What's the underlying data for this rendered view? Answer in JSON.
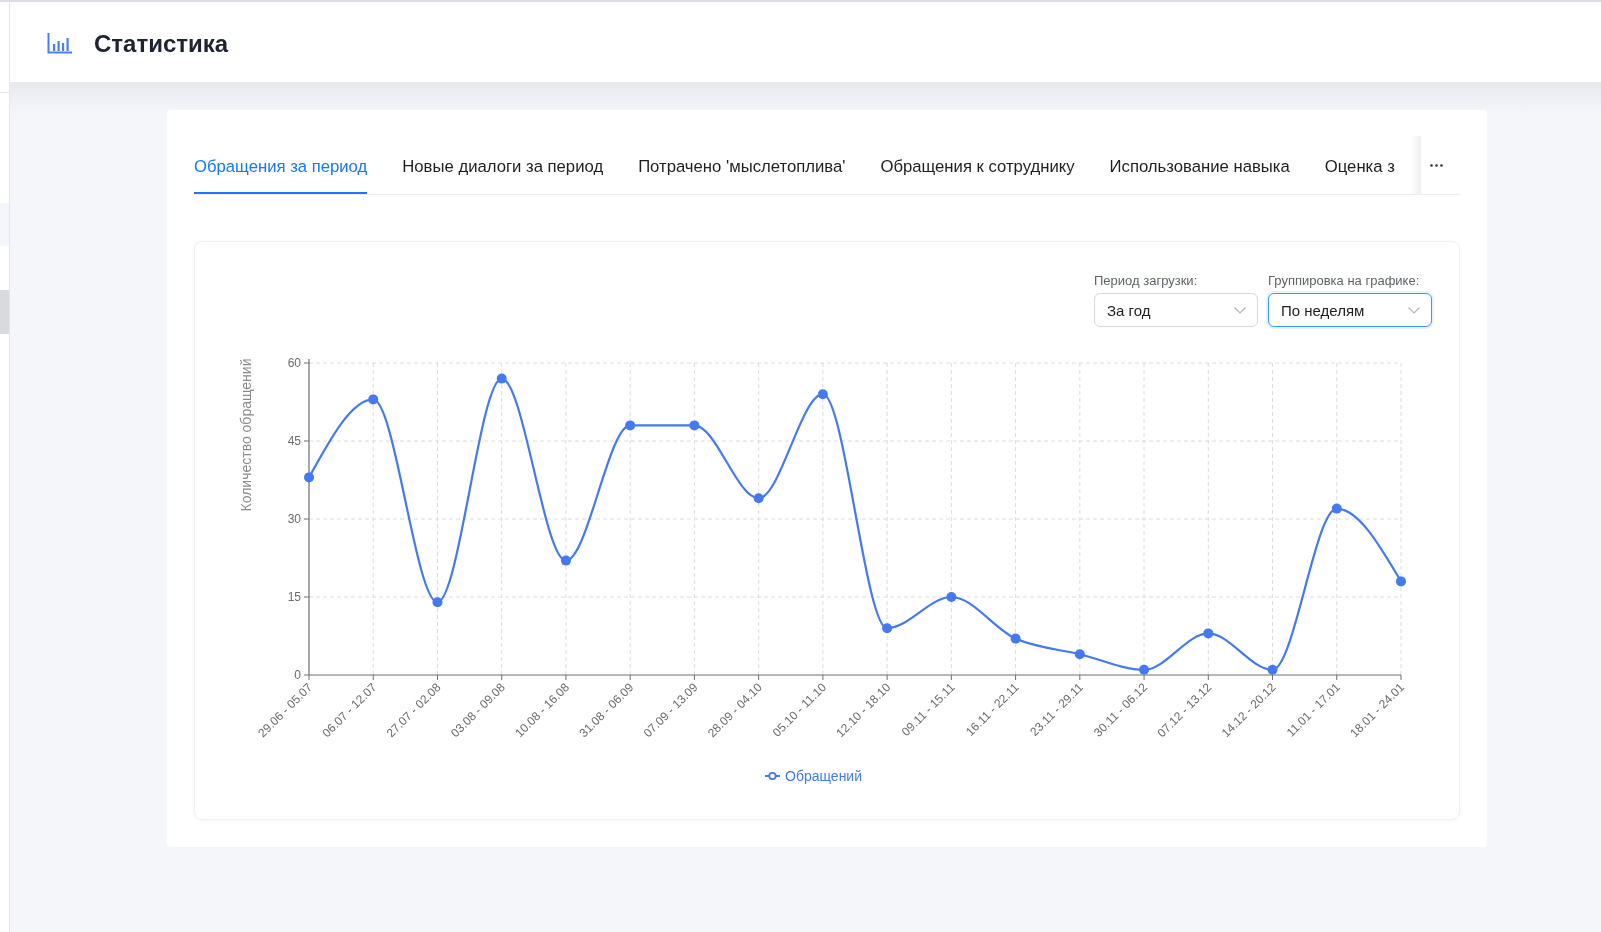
{
  "header": {
    "title": "Статистика"
  },
  "sidebar": {
    "items": [
      {
        "selected": false
      },
      {
        "selected": true
      }
    ]
  },
  "tabs": [
    {
      "label": "Обращения за период",
      "selected": true
    },
    {
      "label": "Новые диалоги за период",
      "selected": false
    },
    {
      "label": "Потрачено 'мыслетоплива'",
      "selected": false
    },
    {
      "label": "Обращения к сотруднику",
      "selected": false
    },
    {
      "label": "Использование навыка",
      "selected": false
    },
    {
      "label": "Оценка з",
      "selected": false
    }
  ],
  "chart_panel": {
    "filters": [
      {
        "label": "Период загрузки:",
        "value": "За год",
        "focused": false
      },
      {
        "label": "Группировка на графике:",
        "value": "По неделям",
        "focused": true
      }
    ],
    "chart_data": {
      "type": "line",
      "ylabel": "Количество обращений",
      "categories": [
        "29.06 - 05.07",
        "06.07 - 12.07",
        "27.07 - 02.08",
        "03.08 - 09.08",
        "10.08 - 16.08",
        "31.08 - 06.09",
        "07.09 - 13.09",
        "28.09 - 04.10",
        "05.10 - 11.10",
        "12.10 - 18.10",
        "09.11 - 15.11",
        "16.11 - 22.11",
        "23.11 - 29.11",
        "30.11 - 06.12",
        "07.12 - 13.12",
        "14.12 - 20.12",
        "11.01 - 17.01",
        "18.01 - 24.01"
      ],
      "series": [
        {
          "name": "Обращений",
          "color": "#4479ef",
          "marker": true,
          "values": [
            38,
            53,
            14,
            57,
            22,
            48,
            48,
            34,
            54,
            9,
            15,
            7,
            4,
            1,
            8,
            1,
            32,
            18
          ]
        }
      ],
      "ylim": [
        0,
        60
      ],
      "yticks": [
        0,
        15,
        30,
        45,
        60
      ],
      "grid": true
    }
  }
}
